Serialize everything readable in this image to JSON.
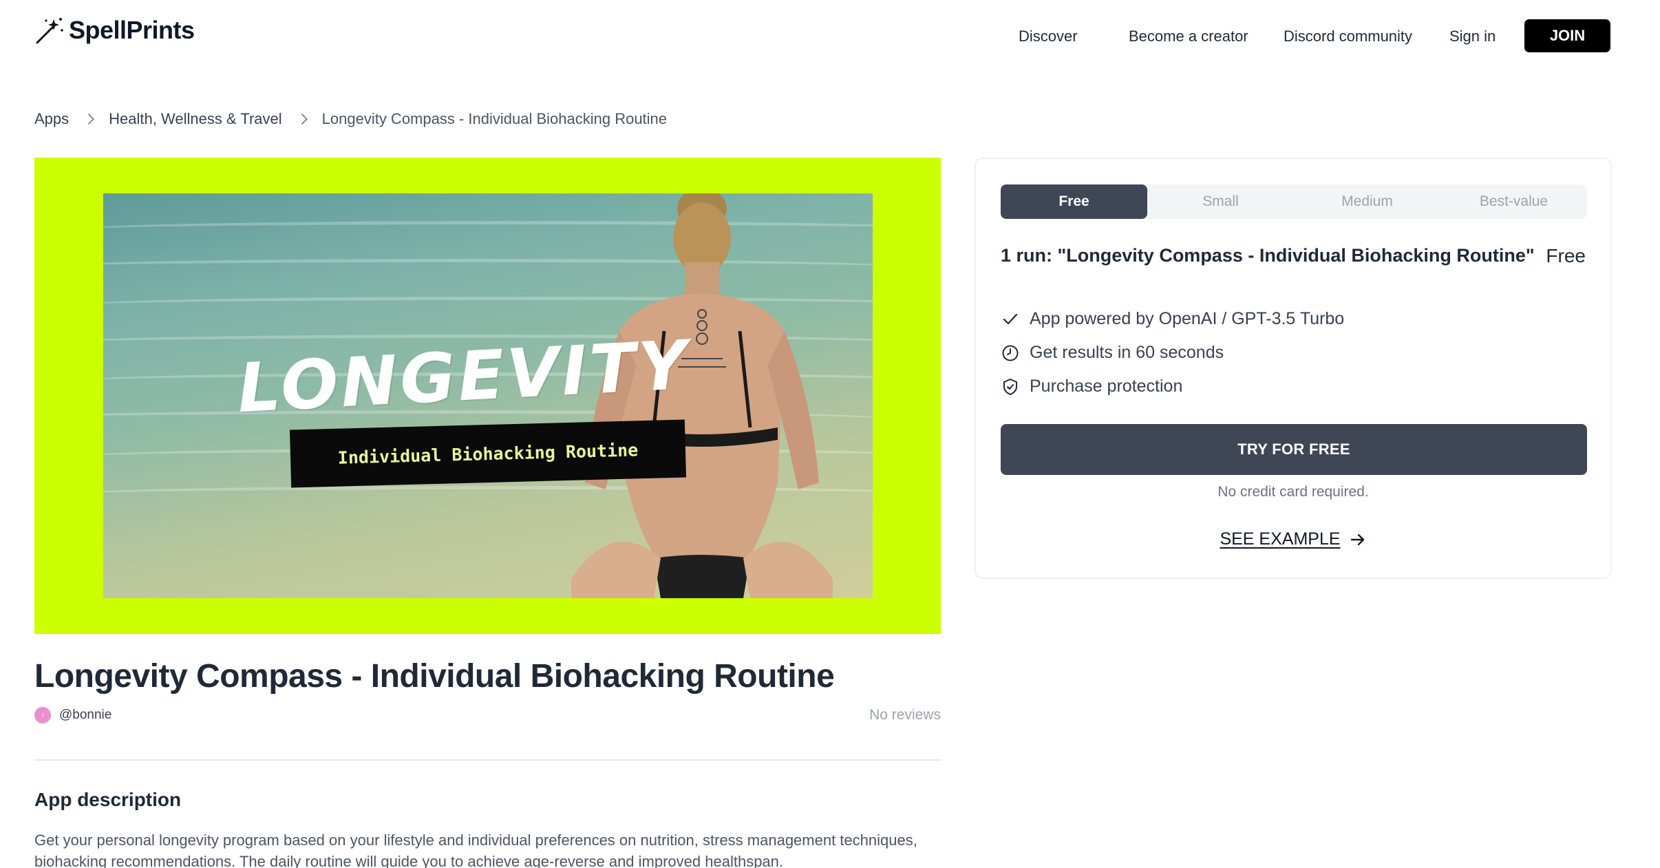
{
  "header": {
    "logo_text": "SpellPrints",
    "nav": {
      "discover": "Discover",
      "become_creator": "Become a creator",
      "discord": "Discord community",
      "sign_in": "Sign in",
      "join": "JOIN"
    }
  },
  "breadcrumb": {
    "items": [
      "Apps",
      "Health, Wellness & Travel",
      "Longevity Compass - Individual Biohacking Routine"
    ]
  },
  "hero": {
    "headline": "LONGEVITY",
    "banner": "Individual Biohacking Routine",
    "accent_color": "#ccff00"
  },
  "app": {
    "title": "Longevity Compass - Individual Biohacking Routine",
    "author": "@bonnie",
    "avatar_initial": "↑",
    "reviews": "No reviews",
    "description_title": "App description",
    "description": "Get your personal longevity program based on your lifestyle and individual preferences on nutrition, stress management techniques, biohacking recommendations. The daily routine will guide you to achieve age-reverse and improved healthspan."
  },
  "pricing": {
    "tabs": [
      "Free",
      "Small",
      "Medium",
      "Best-value"
    ],
    "selected_tab": "Free",
    "run_title": "1 run: \"Longevity Compass - Individual Biohacking Routine\"",
    "price": "Free",
    "features": [
      {
        "icon": "check-icon",
        "text": "App powered by OpenAI / GPT-3.5 Turbo"
      },
      {
        "icon": "clock-icon",
        "text": "Get results in 60 seconds"
      },
      {
        "icon": "shield-check-icon",
        "text": "Purchase protection"
      }
    ],
    "cta": "TRY FOR FREE",
    "cta_note": "No credit card required.",
    "see_example": "SEE EXAMPLE"
  }
}
